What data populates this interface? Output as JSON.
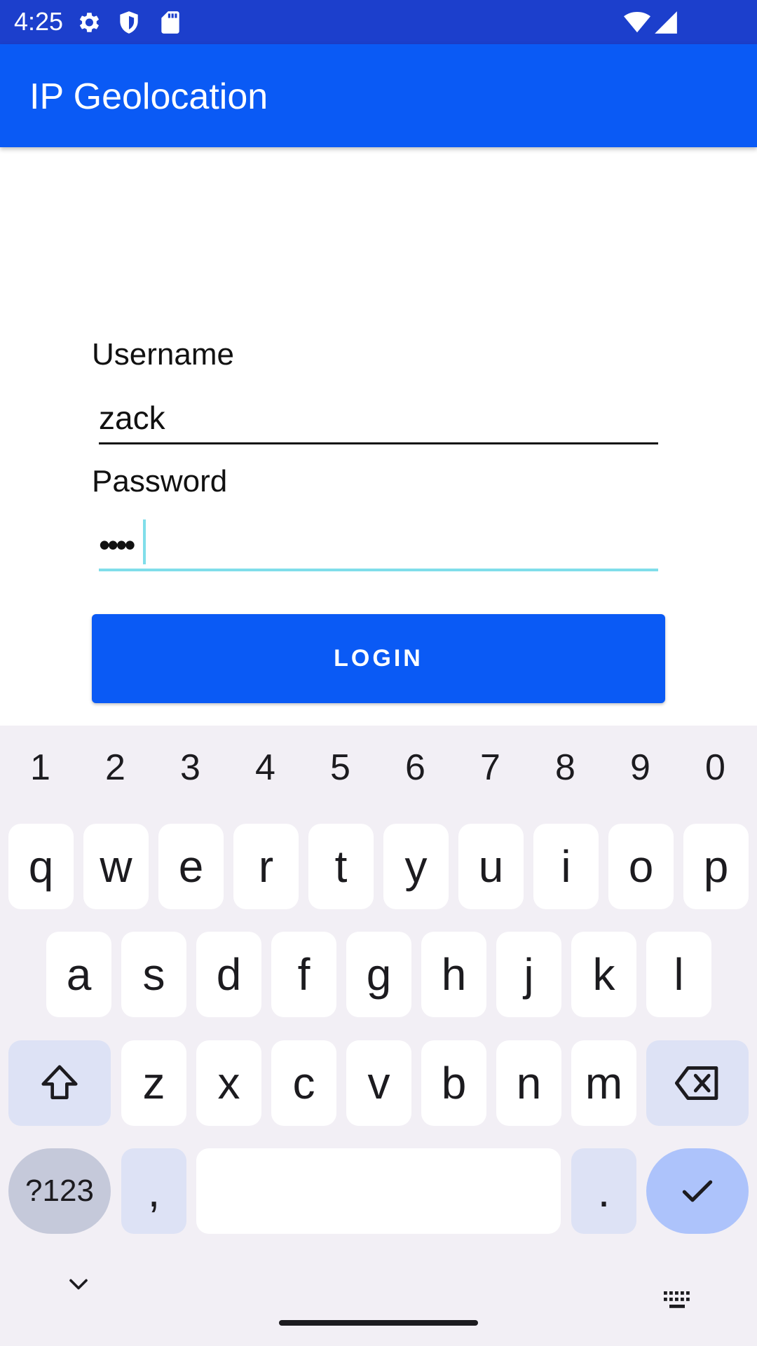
{
  "status_bar": {
    "time": "4:25",
    "icons": [
      "settings-icon",
      "shield-icon",
      "sd-card-icon",
      "wifi-icon",
      "signal-icon"
    ]
  },
  "app_bar": {
    "title": "IP Geolocation"
  },
  "form": {
    "username_label": "Username",
    "username_value": "zack",
    "password_label": "Password",
    "password_value": "••••",
    "login_label": "LOGIN"
  },
  "keyboard": {
    "numbers": [
      "1",
      "2",
      "3",
      "4",
      "5",
      "6",
      "7",
      "8",
      "9",
      "0"
    ],
    "row1": [
      "q",
      "w",
      "e",
      "r",
      "t",
      "y",
      "u",
      "i",
      "o",
      "p"
    ],
    "row2": [
      "a",
      "s",
      "d",
      "f",
      "g",
      "h",
      "j",
      "k",
      "l"
    ],
    "row3": [
      "z",
      "x",
      "c",
      "v",
      "b",
      "n",
      "m"
    ],
    "symbols_key": "?123",
    "comma_key": ",",
    "period_key": "."
  },
  "colors": {
    "primary": "#0a5af5",
    "status_bar": "#1c3fcc",
    "focus_accent": "#80deea",
    "keyboard_bg": "#f2eff5"
  }
}
